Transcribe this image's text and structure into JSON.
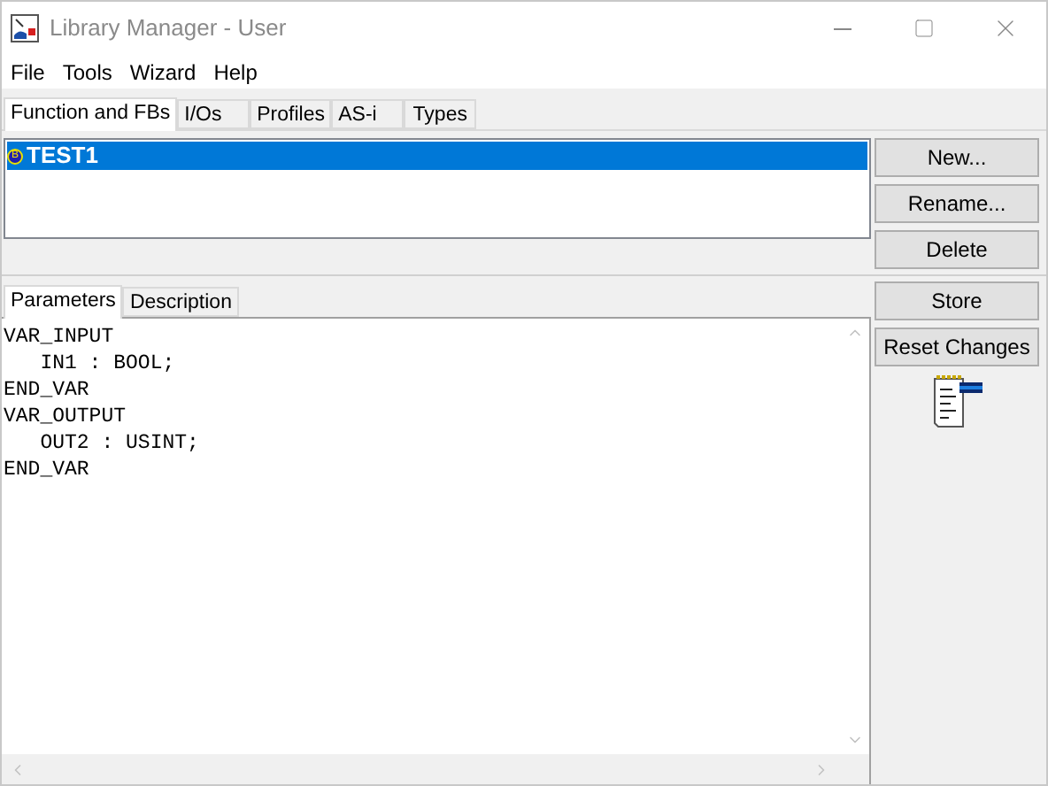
{
  "window": {
    "title": "Library Manager - User"
  },
  "menu": [
    "File",
    "Tools",
    "Wizard",
    "Help"
  ],
  "tabs": [
    {
      "label": "Function and FBs",
      "selected": true
    },
    {
      "label": "I/Os",
      "selected": false
    },
    {
      "label": "Profiles",
      "selected": false
    },
    {
      "label": "AS-i",
      "selected": false
    },
    {
      "label": "Types",
      "selected": false
    }
  ],
  "list": {
    "items": [
      {
        "badge": "B",
        "name": "TEST1",
        "selected": true
      }
    ]
  },
  "list_buttons": [
    "New...",
    "Rename...",
    "Delete"
  ],
  "editor_tabs": [
    {
      "label": "Parameters",
      "selected": true
    },
    {
      "label": "Description",
      "selected": false
    }
  ],
  "editor": {
    "lines": [
      "VAR_INPUT",
      "   IN1 : BOOL;",
      "END_VAR",
      "VAR_OUTPUT",
      "   OUT2 : USINT;",
      "END_VAR"
    ]
  },
  "editor_buttons": [
    "Store",
    "Reset Changes"
  ]
}
